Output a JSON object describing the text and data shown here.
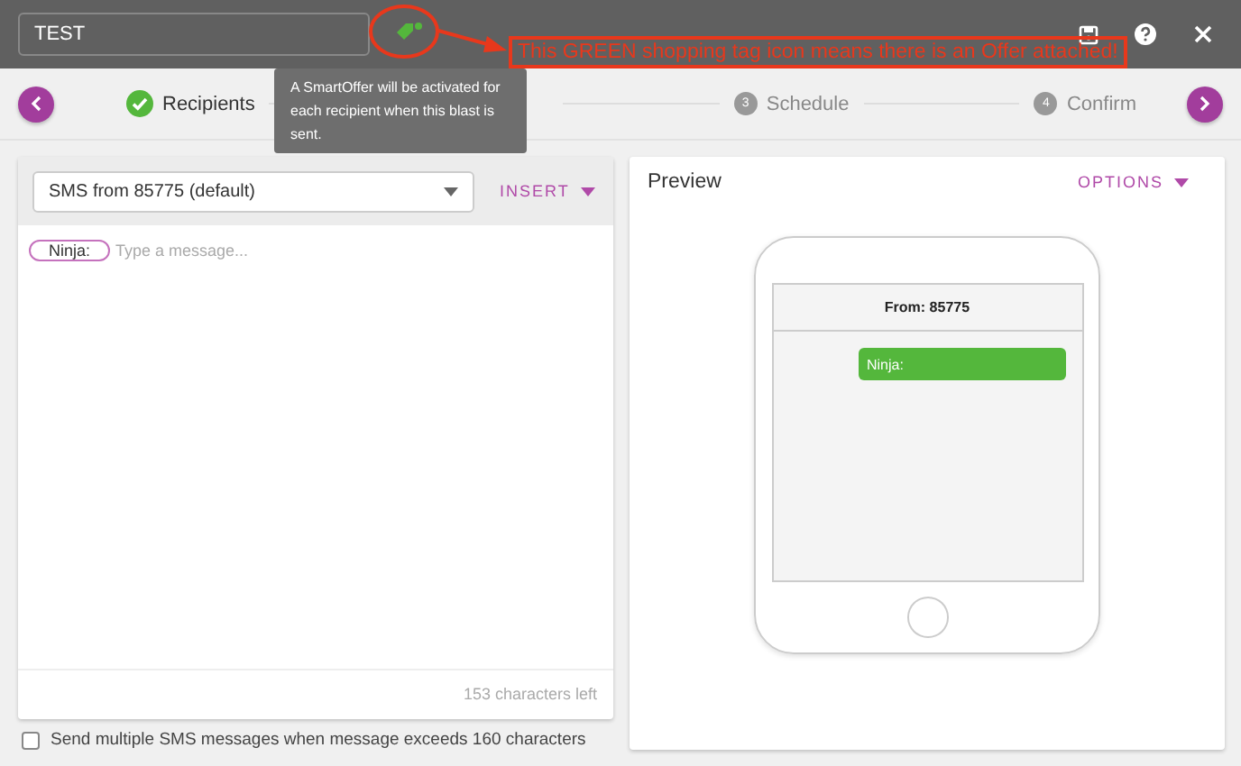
{
  "header": {
    "title": "TEST",
    "offer_attached": true
  },
  "annotation": {
    "text": "This GREEN shopping tag icon means there is an Offer attached!"
  },
  "tooltip": {
    "text": "A SmartOffer will be activated for each recipient when this blast is sent."
  },
  "steps": [
    {
      "kind": "step",
      "label": "Recipients",
      "done": true,
      "selected": false
    },
    {
      "kind": "covered"
    },
    {
      "kind": "step",
      "number": "3",
      "label": "Schedule",
      "done": false,
      "selected": false
    },
    {
      "kind": "step",
      "number": "4",
      "label": "Confirm",
      "done": false,
      "selected": false
    }
  ],
  "composer": {
    "sender": "SMS from 85775 (default)",
    "insert": "INSERT",
    "tag": "Ninja:",
    "placeholder": "Type a message...",
    "counter": "153 characters left"
  },
  "multi_sms": {
    "label": "Send multiple SMS messages when message exceeds 160 characters",
    "checked": false
  },
  "preview": {
    "title": "Preview",
    "options": "OPTIONS",
    "from": "From: 85775",
    "bubble": "Ninja:"
  }
}
